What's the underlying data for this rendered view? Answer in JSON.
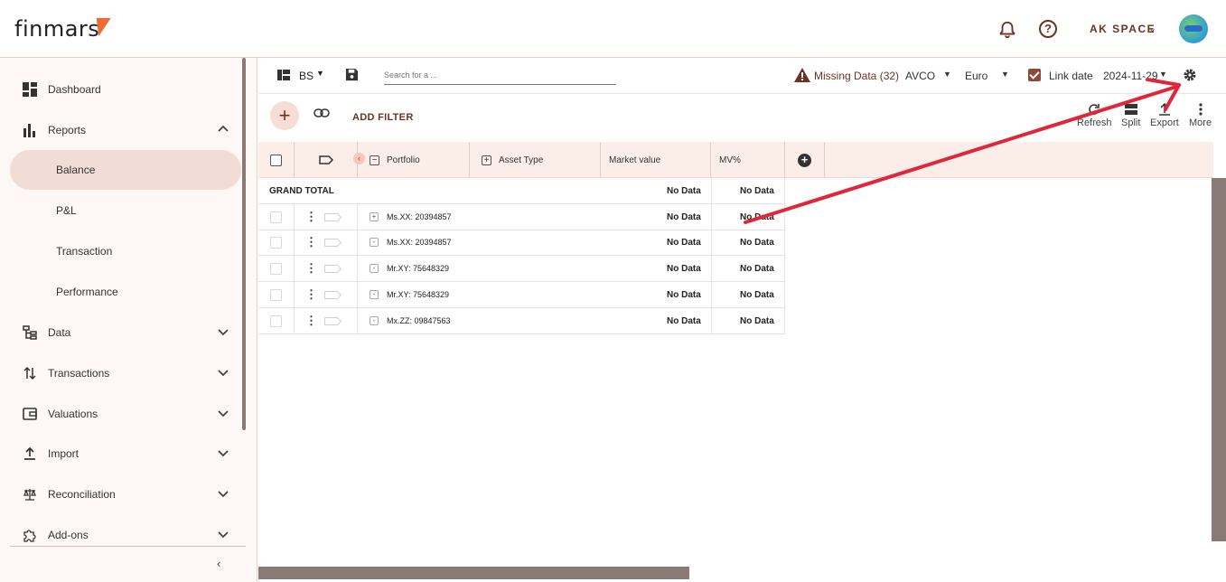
{
  "app": {
    "logo_text": "finmars",
    "space_name": "AK SPACE"
  },
  "colors": {
    "accent": "#6b3320",
    "brand": "#f06a35",
    "active_bg": "#f2ddd6",
    "header_bg": "#fbeee9",
    "annotation": "#e0273a"
  },
  "sidebar": {
    "items": [
      {
        "label": "Dashboard",
        "icon": "dashboard-icon"
      },
      {
        "label": "Reports",
        "icon": "bar-chart-icon",
        "expanded": true
      },
      {
        "label": "Data",
        "icon": "tree-icon"
      },
      {
        "label": "Transactions",
        "icon": "swap-vertical-icon"
      },
      {
        "label": "Valuations",
        "icon": "wallet-icon"
      },
      {
        "label": "Import",
        "icon": "upload-icon"
      },
      {
        "label": "Reconciliation",
        "icon": "scale-icon"
      },
      {
        "label": "Add-ons",
        "icon": "puzzle-icon"
      }
    ],
    "report_subitems": [
      {
        "label": "Balance",
        "active": true
      },
      {
        "label": "P&L"
      },
      {
        "label": "Transaction"
      },
      {
        "label": "Performance"
      }
    ]
  },
  "toolbar": {
    "layout_name": "BS",
    "search_placeholder": "Search for a ...",
    "missing_data": "Missing Data (32)",
    "cost_method": "AVCO",
    "currency": "Euro",
    "link_date_label": "Link date",
    "link_date_checked": true,
    "report_date": "2024-11-29"
  },
  "actions": {
    "add_filter": "ADD FILTER",
    "refresh": "Refresh",
    "split": "Split",
    "export": "Export",
    "more": "More"
  },
  "grid": {
    "columns": [
      "Portfolio",
      "Asset Type",
      "Market value",
      "MV%"
    ],
    "grand_total": {
      "label": "GRAND TOTAL",
      "market_value": "No Data",
      "mv_percent": "No Data"
    },
    "rows": [
      {
        "toggle": "+",
        "portfolio": "Ms.XX: 20394857",
        "market_value": "No Data",
        "mv_percent": "No Data"
      },
      {
        "toggle": "-",
        "portfolio": "Ms.XX: 20394857",
        "market_value": "No Data",
        "mv_percent": "No Data"
      },
      {
        "toggle": "-",
        "portfolio": "Mr.XY: 75648329",
        "market_value": "No Data",
        "mv_percent": "No Data"
      },
      {
        "toggle": "-",
        "portfolio": "Mr.XY: 75648329",
        "market_value": "No Data",
        "mv_percent": "No Data"
      },
      {
        "toggle": "-",
        "portfolio": "Mx.ZZ: 09847563",
        "market_value": "No Data",
        "mv_percent": "No Data"
      }
    ]
  }
}
